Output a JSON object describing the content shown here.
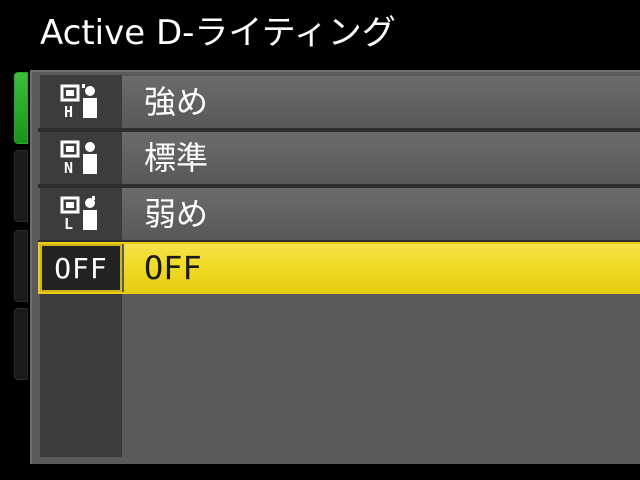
{
  "screen": {
    "title": "Active D-ライティング"
  },
  "side_tabs": [
    {
      "id": "tab-1",
      "active": true
    },
    {
      "id": "tab-2",
      "active": false
    },
    {
      "id": "tab-3",
      "active": false
    },
    {
      "id": "tab-4",
      "active": false
    }
  ],
  "options": [
    {
      "icon": "adl-high-icon",
      "icon_letter": "H",
      "label": "強め",
      "selected": false
    },
    {
      "icon": "adl-normal-icon",
      "icon_letter": "N",
      "label": "標準",
      "selected": false
    },
    {
      "icon": "adl-low-icon",
      "icon_letter": "L",
      "label": "弱め",
      "selected": false
    },
    {
      "icon": "off-badge",
      "icon_text": "OFF",
      "label": "OFF",
      "selected": true
    }
  ],
  "colors": {
    "highlight": "#f2dc2a",
    "active_tab": "#2aa52a",
    "panel": "#5a5a5a"
  }
}
